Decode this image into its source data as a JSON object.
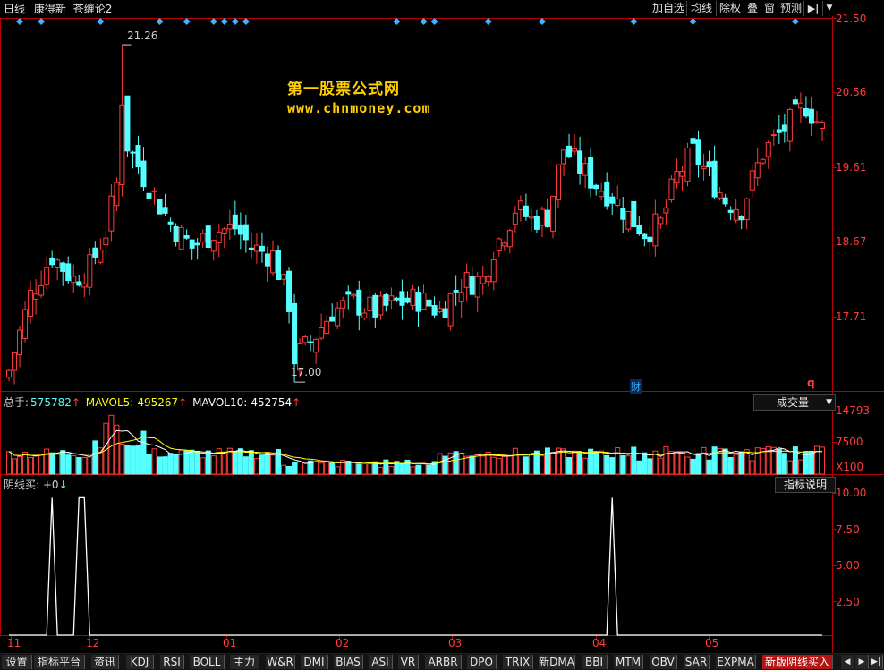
{
  "header": {
    "period": "日线",
    "stock_name": "康得新",
    "formula": "苍缠论2",
    "buttons": [
      "加自选",
      "均线",
      "除权",
      "叠",
      "窗",
      "预测"
    ],
    "nav_icon": "▶|",
    "menu_icon": "▼"
  },
  "watermark": {
    "line1": "第一股票公式网",
    "line2": "www.chnmoney.com"
  },
  "price_panel": {
    "y_ticks": [
      "21.50",
      "20.56",
      "19.61",
      "18.67",
      "17.71"
    ],
    "high_label": "21.26",
    "low_label": "17.00",
    "cai_marker": "财",
    "q_marker": "q"
  },
  "volume_panel": {
    "total_label": "总手:",
    "total_value": "575782",
    "mavol5_label": "MAVOL5:",
    "mavol5_value": "495267",
    "mavol10_label": "MAVOL10:",
    "mavol10_value": "452754",
    "arrow": "↑",
    "dropdown": "成交量",
    "y_ticks": [
      "14793",
      "7500"
    ],
    "unit": "X100"
  },
  "indicator_panel": {
    "name": "阴线买:",
    "value": "+0",
    "arrow": "↓",
    "explain_button": "指标说明",
    "y_ticks": [
      "10.00",
      "7.50",
      "5.00",
      "2.50"
    ]
  },
  "x_axis": [
    "11",
    "12",
    "01",
    "02",
    "03",
    "04",
    "05"
  ],
  "tabs": [
    "设置",
    "指标平台",
    "资讯",
    "KDJ",
    "RSI",
    "BOLL",
    "主力",
    "W&R",
    "DMI",
    "BIAS",
    "ASI",
    "VR",
    "ARBR",
    "DPO",
    "TRIX",
    "新DMA",
    "BBI",
    "MTM",
    "OBV",
    "SAR",
    "EXPMA",
    "新版阴线买入"
  ],
  "colors": {
    "up": "#ff3c3c",
    "down": "#54ffff",
    "axis": "#b40000",
    "ma5": "#ffffff",
    "ma10": "#ffff00",
    "marker": "#3cb4ff",
    "accent": "#b41414"
  },
  "chart_data": [
    {
      "type": "candlestick",
      "ylim": [
        16.9,
        21.6
      ],
      "summary": {
        "high": 21.26,
        "low": 17.0,
        "last": 20.2
      },
      "bars": 152
    },
    {
      "type": "bar",
      "ylim": [
        0,
        14793
      ],
      "unit": "X100"
    },
    {
      "type": "line",
      "ylim": [
        0,
        10
      ],
      "x": [
        "11",
        "12",
        "01",
        "02",
        "03",
        "04",
        "05"
      ]
    }
  ]
}
